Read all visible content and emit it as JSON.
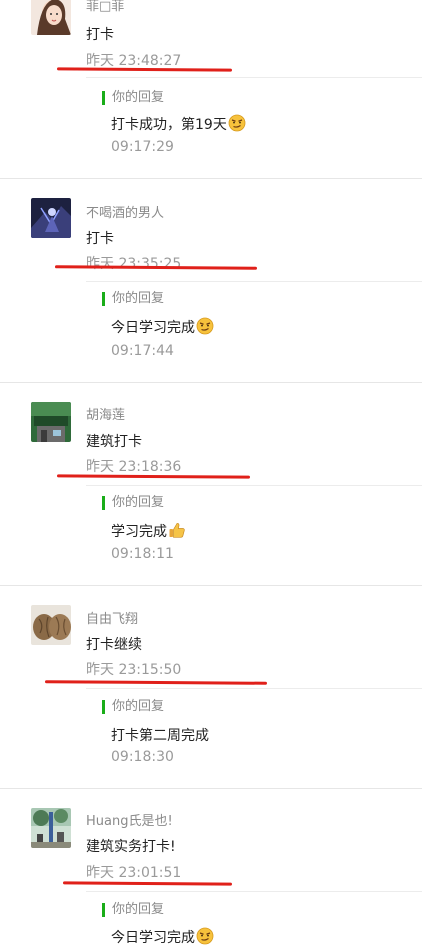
{
  "comments": [
    {
      "name": "菲□菲",
      "text": "打卡",
      "time": "昨天 23:48:27",
      "reply_label": "你的回复",
      "reply_text": "打卡成功，第19天",
      "reply_emoji": "smirk-face-emoji",
      "reply_time": "09:17:29",
      "accent": "#1aad19"
    },
    {
      "name": "不喝酒的男人",
      "text": "打卡",
      "time": "昨天 23:35:25",
      "reply_label": "你的回复",
      "reply_text": "今日学习完成",
      "reply_emoji": "smirk-face-emoji",
      "reply_time": "09:17:44"
    },
    {
      "name": "胡海莲",
      "text": "建筑打卡",
      "time": "昨天 23:18:36",
      "reply_label": "你的回复",
      "reply_text": "学习完成",
      "reply_emoji": "thumbs-up-emoji",
      "reply_time": "09:18:11"
    },
    {
      "name": "自由飞翔",
      "text": "打卡继续",
      "time": "昨天 23:15:50",
      "reply_label": "你的回复",
      "reply_text": "打卡第二周完成",
      "reply_emoji": "",
      "reply_time": "09:18:30"
    },
    {
      "name": "Huang氏是也!",
      "text": "建筑实务打卡!",
      "time": "昨天 23:01:51",
      "reply_label": "你的回复",
      "reply_text": "今日学习完成",
      "reply_emoji": "smirk-face-emoji",
      "reply_time": ""
    }
  ],
  "annotation_color": "#e0201a"
}
